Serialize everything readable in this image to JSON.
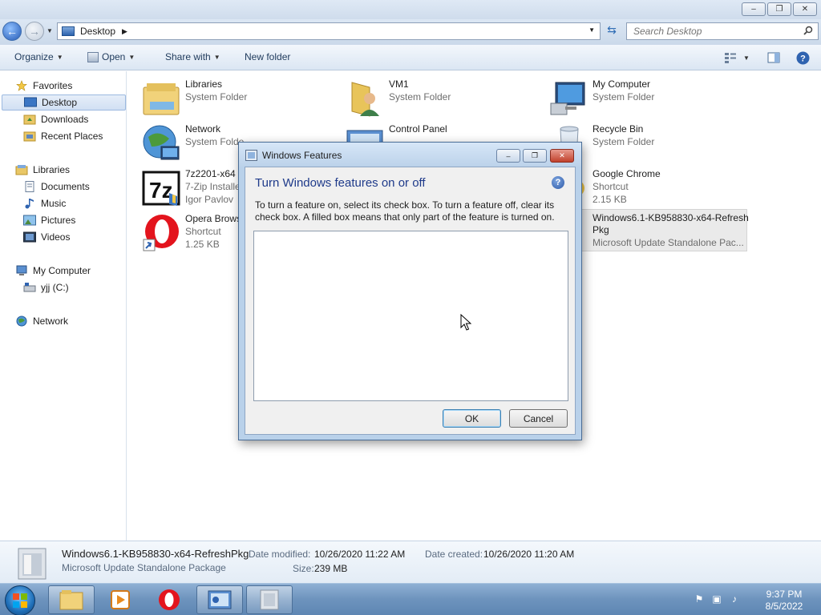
{
  "titlebar": {
    "minimize": "–",
    "maximize": "❐",
    "close": "✕"
  },
  "address": {
    "location": "Desktop",
    "search_placeholder": "Search Desktop"
  },
  "toolbar": {
    "organize": "Organize",
    "open": "Open",
    "share_with": "Share with",
    "new_folder": "New folder"
  },
  "nav": {
    "favorites": "Favorites",
    "desktop": "Desktop",
    "downloads": "Downloads",
    "recent_places": "Recent Places",
    "libraries": "Libraries",
    "documents": "Documents",
    "music": "Music",
    "pictures": "Pictures",
    "videos": "Videos",
    "my_computer": "My Computer",
    "drive": "yjj (C:)",
    "network": "Network"
  },
  "files": [
    {
      "name": "Libraries",
      "sub1": "System Folder",
      "sub2": ""
    },
    {
      "name": "Network",
      "sub1": "System Folde",
      "sub2": ""
    },
    {
      "name": "7z2201-x64",
      "sub1": "7-Zip Installe",
      "sub2": "Igor Pavlov"
    },
    {
      "name": "Opera Brows",
      "sub1": "Shortcut",
      "sub2": "1.25 KB"
    },
    {
      "name": "VM1",
      "sub1": "System Folder",
      "sub2": ""
    },
    {
      "name": "Control Panel",
      "sub1": "",
      "sub2": ""
    },
    {
      "name": "My Computer",
      "sub1": "System Folder",
      "sub2": ""
    },
    {
      "name": "Recycle Bin",
      "sub1": "System Folder",
      "sub2": ""
    },
    {
      "name": "Google Chrome",
      "sub1": "Shortcut",
      "sub2": "2.15 KB"
    },
    {
      "name": "Windows6.1-KB958830-x64-Refresh",
      "name2": "Pkg",
      "sub1": "Microsoft Update Standalone Pac..."
    }
  ],
  "details": {
    "filename": "Windows6.1-KB958830-x64-RefreshPkg",
    "type": "Microsoft Update Standalone Package",
    "date_modified_label": "Date modified:",
    "date_modified": "10/26/2020 11:22 AM",
    "date_created_label": "Date created:",
    "date_created": "10/26/2020 11:20 AM",
    "size_label": "Size:",
    "size": "239 MB"
  },
  "dialog": {
    "title": "Windows Features",
    "heading": "Turn Windows features on or off",
    "description": "To turn a feature on, select its check box. To turn a feature off, clear its check box. A filled box means that only part of the feature is turned on.",
    "help": "?",
    "ok": "OK",
    "cancel": "Cancel"
  },
  "taskbar": {
    "time": "9:37 PM",
    "date": "8/5/2022"
  }
}
